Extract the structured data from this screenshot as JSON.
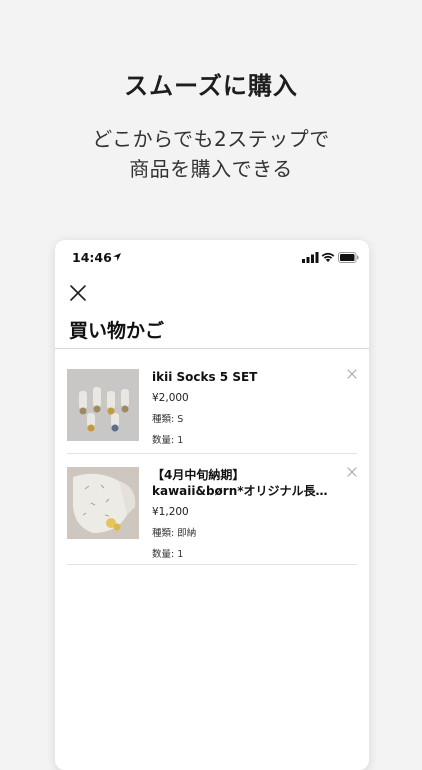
{
  "promo": {
    "title": "スムーズに購入",
    "subtitle_line1": "どこからでも2ステップで",
    "subtitle_line2": "商品を購入できる"
  },
  "status_bar": {
    "time": "14:46",
    "icons": [
      "location-arrow-icon",
      "signal-icon",
      "wifi-icon",
      "battery-icon"
    ]
  },
  "cart": {
    "title": "買い物かご",
    "items": [
      {
        "name": "ikii Socks 5 SET",
        "price": "¥2,000",
        "type": "種類: S",
        "quantity": "数量: 1"
      },
      {
        "name_line1": "【4月中旬納期】",
        "name_line2": "kawaii&børn*オリジナル長…",
        "price": "¥1,200",
        "type": "種類: 即納",
        "quantity": "数量: 1"
      }
    ]
  }
}
